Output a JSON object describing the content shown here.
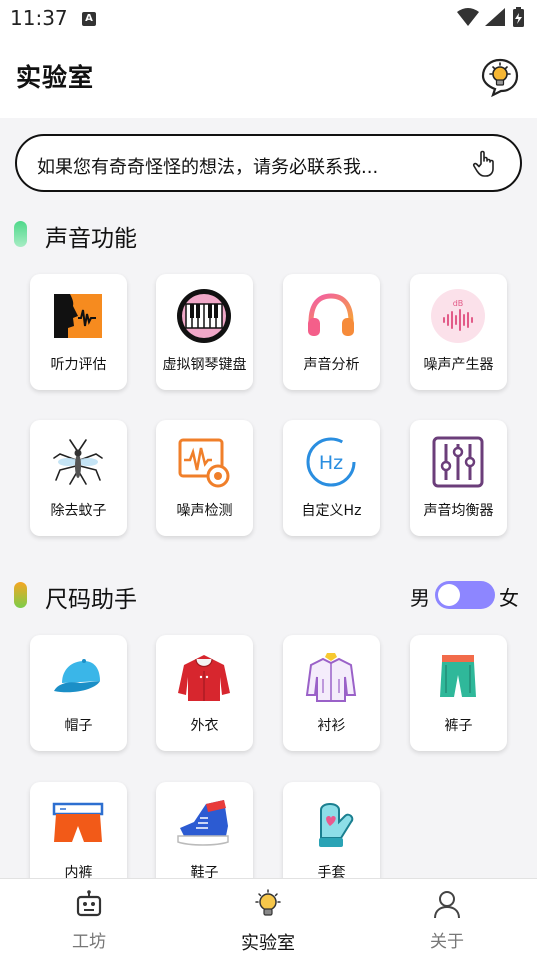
{
  "status": {
    "time": "11:37",
    "badge": "A"
  },
  "header": {
    "title": "实验室"
  },
  "notice": {
    "text": "如果您有奇奇怪怪的想法，请务必联系我..."
  },
  "sound_section": {
    "title": "声音功能",
    "items": [
      {
        "label": "听力评估",
        "icon": "hearing-test-icon"
      },
      {
        "label": "虚拟钢琴键盘",
        "icon": "piano-icon"
      },
      {
        "label": "声音分析",
        "icon": "headphones-icon"
      },
      {
        "label": "噪声产生器",
        "icon": "noise-generator-icon"
      },
      {
        "label": "除去蚊子",
        "icon": "mosquito-icon"
      },
      {
        "label": "噪声检测",
        "icon": "noise-detector-icon"
      },
      {
        "label": "自定义Hz",
        "icon": "hz-icon"
      },
      {
        "label": "声音均衡器",
        "icon": "equalizer-icon"
      }
    ]
  },
  "size_section": {
    "title": "尺码助手",
    "gender": {
      "male": "男",
      "female": "女"
    },
    "items": [
      {
        "label": "帽子",
        "icon": "cap-icon"
      },
      {
        "label": "外衣",
        "icon": "hoodie-icon"
      },
      {
        "label": "衬衫",
        "icon": "shirt-icon"
      },
      {
        "label": "裤子",
        "icon": "shorts-icon"
      },
      {
        "label": "内裤",
        "icon": "underwear-icon"
      },
      {
        "label": "鞋子",
        "icon": "sneaker-icon"
      },
      {
        "label": "手套",
        "icon": "mitten-icon"
      }
    ]
  },
  "nav": {
    "items": [
      {
        "label": "工坊",
        "icon": "robot-icon"
      },
      {
        "label": "实验室",
        "icon": "bulb-icon",
        "active": true
      },
      {
        "label": "关于",
        "icon": "user-icon"
      }
    ]
  },
  "colors": {
    "toggle": "#8d86ff",
    "section_green": "#7ee0a8",
    "section_orange": "#f5a623"
  }
}
